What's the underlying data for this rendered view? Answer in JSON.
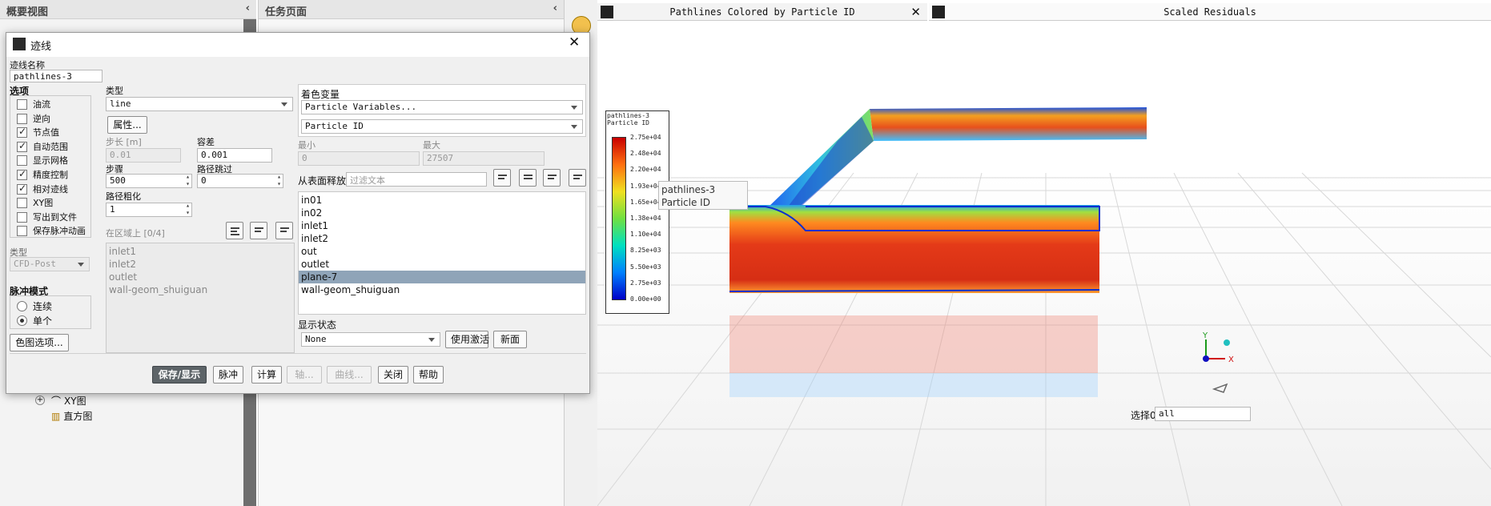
{
  "left_panel": {
    "title": "概要视图",
    "items": [
      "XY图",
      "直方图"
    ]
  },
  "task_panel": {
    "title": "任务页面"
  },
  "dialog": {
    "title": "迹线",
    "name_label": "迹线名称",
    "name_value": "pathlines-3",
    "options_label": "选项",
    "options": [
      {
        "label": "油流",
        "checked": false
      },
      {
        "label": "逆向",
        "checked": false
      },
      {
        "label": "节点值",
        "checked": true
      },
      {
        "label": "自动范围",
        "checked": true
      },
      {
        "label": "显示网格",
        "checked": false
      },
      {
        "label": "精度控制",
        "checked": true
      },
      {
        "label": "相对迹线",
        "checked": true
      },
      {
        "label": "XY图",
        "checked": false
      },
      {
        "label": "写出到文件",
        "checked": false
      },
      {
        "label": "保存脉冲动画",
        "checked": false
      }
    ],
    "type_label": "类型",
    "type_value": "line",
    "attributes_button": "属性...",
    "step_length_label": "步长 [m]",
    "step_length_value": "0.01",
    "tolerance_label": "容差",
    "tolerance_value": "0.001",
    "steps_label": "步骤",
    "steps_value": "500",
    "path_skip_label": "路径跳过",
    "path_skip_value": "0",
    "path_coarsen_label": "路径粗化",
    "path_coarsen_value": "1",
    "on_zone_label": "在区域上 [0/4]",
    "zones": [
      "inlet1",
      "inlet2",
      "outlet",
      "wall-geom_shuiguan"
    ],
    "export_type_label": "类型",
    "export_type_value": "CFD-Post",
    "pulse_mode_label": "脉冲模式",
    "pulse_modes": [
      {
        "label": "连续",
        "checked": false
      },
      {
        "label": "单个",
        "checked": true
      }
    ],
    "colormap_button": "色图选项...",
    "color_by_label": "着色变量",
    "color_by_category": "Particle Variables...",
    "color_by_variable": "Particle ID",
    "min_label": "最小",
    "min_value": "0",
    "max_label": "最大",
    "max_value": "27507",
    "release_label": "从表面释放",
    "filter_placeholder": "过滤文本",
    "surfaces": [
      "in01",
      "in02",
      "inlet1",
      "inlet2",
      "out",
      "outlet",
      "plane-7",
      "wall-geom_shuiguan"
    ],
    "selected_surface": "plane-7",
    "display_state_label": "显示状态",
    "display_state_value": "None",
    "use_active_button": "使用激活",
    "new_button": "新面",
    "buttons": {
      "save_display": "保存/显示",
      "pulse": "脉冲",
      "compute": "计算",
      "axes": "轴...",
      "curves": "曲线...",
      "close": "关闭",
      "help": "帮助"
    }
  },
  "graphics": {
    "tab1": "Pathlines Colored by Particle ID",
    "tab2": "Scaled Residuals",
    "legend_title_1": "pathlines-3",
    "legend_title_2": "Particle ID",
    "legend_ticks": [
      "2.75e+04",
      "2.48e+04",
      "2.20e+04",
      "1.93e+04",
      "1.65e+04",
      "1.38e+04",
      "1.10e+04",
      "8.25e+03",
      "5.50e+03",
      "2.75e+03",
      "0.00e+00"
    ],
    "tooltip_1": "pathlines-3",
    "tooltip_2": "Particle ID",
    "axes": {
      "x": "X",
      "y": "Y"
    },
    "select_label": "选择0",
    "select_value": "all"
  },
  "colors": {
    "accent": "#5d6468",
    "selection": "#8fa4b8"
  }
}
